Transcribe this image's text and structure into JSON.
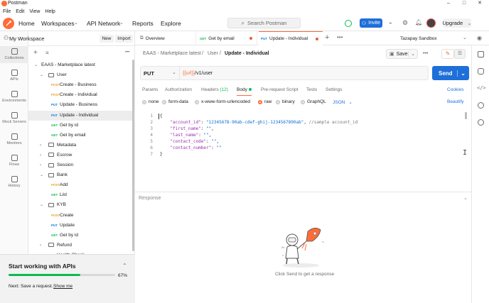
{
  "window": {
    "title": "Postman",
    "minimize": "–",
    "maximize": "□",
    "close": "✕"
  },
  "menu": [
    "File",
    "Edit",
    "View",
    "Help"
  ],
  "header": {
    "home": "Home",
    "workspaces": "Workspaces",
    "api_network": "API Network",
    "reports": "Reports",
    "explore": "Explore",
    "search_placeholder": "Search Postman",
    "invite": "Invite",
    "upgrade": "Upgrade"
  },
  "rail": [
    {
      "label": "Collections",
      "icon": "collections-icon"
    },
    {
      "label": "APIs",
      "icon": "apis-icon"
    },
    {
      "label": "Environments",
      "icon": "environments-icon"
    },
    {
      "label": "Mock Servers",
      "icon": "mock-servers-icon"
    },
    {
      "label": "Monitors",
      "icon": "monitors-icon"
    },
    {
      "label": "Flows",
      "icon": "flows-icon"
    },
    {
      "label": "History",
      "icon": "history-icon"
    }
  ],
  "sidebar": {
    "workspace_name": "My Workspace",
    "new_label": "New",
    "import_label": "Import",
    "tree": [
      {
        "label": "EAAS - Marketplace latest",
        "kind": "collection",
        "depth": 0,
        "open": true
      },
      {
        "label": "User",
        "kind": "folder",
        "depth": 1,
        "open": true
      },
      {
        "label": "Create - Business",
        "kind": "request",
        "method": "POST",
        "depth": 2
      },
      {
        "label": "Create - Individual",
        "kind": "request",
        "method": "POST",
        "depth": 2
      },
      {
        "label": "Update - Business",
        "kind": "request",
        "method": "PUT",
        "depth": 2
      },
      {
        "label": "Update - Individual",
        "kind": "request",
        "method": "PUT",
        "depth": 2,
        "selected": true
      },
      {
        "label": "Get by id",
        "kind": "request",
        "method": "GET",
        "depth": 2
      },
      {
        "label": "Get by email",
        "kind": "request",
        "method": "GET",
        "depth": 2
      },
      {
        "label": "Metadata",
        "kind": "folder",
        "depth": 1,
        "open": false
      },
      {
        "label": "Escrow",
        "kind": "folder",
        "depth": 1,
        "open": false
      },
      {
        "label": "Session",
        "kind": "folder",
        "depth": 1,
        "open": false
      },
      {
        "label": "Bank",
        "kind": "folder",
        "depth": 1,
        "open": true
      },
      {
        "label": "Add",
        "kind": "request",
        "method": "POST",
        "depth": 2
      },
      {
        "label": "List",
        "kind": "request",
        "method": "GET",
        "depth": 2
      },
      {
        "label": "KYB",
        "kind": "folder",
        "depth": 1,
        "open": true
      },
      {
        "label": "Create",
        "kind": "request",
        "method": "POST",
        "depth": 2
      },
      {
        "label": "Update",
        "kind": "request",
        "method": "PUT",
        "depth": 2
      },
      {
        "label": "Get by id",
        "kind": "request",
        "method": "GET",
        "depth": 2
      },
      {
        "label": "Refund",
        "kind": "folder",
        "depth": 1,
        "open": false
      },
      {
        "label": "Health Check",
        "kind": "request",
        "method": "GET",
        "depth": 1
      }
    ]
  },
  "start_panel": {
    "title": "Start working with APIs",
    "progress": 0.67,
    "progress_text": "67%",
    "next_prefix": "Next: Save a request.",
    "show_me": "Show me"
  },
  "tabs": [
    {
      "label": "Overview",
      "method": ""
    },
    {
      "label": "Get by email",
      "method": "GET",
      "dirty": true
    },
    {
      "label": "Update - Individual",
      "method": "PUT",
      "dirty": true,
      "active": true
    }
  ],
  "environment": "Tazapay Sandbox",
  "breadcrumb": {
    "collection": "EAAS - Marketplace latest",
    "sep": "/",
    "folder": "User",
    "request": "Update - Individual"
  },
  "save_label": "Save",
  "request": {
    "method": "PUT",
    "url_var": "{{url}}",
    "url_path": "/v1/user",
    "send_label": "Send"
  },
  "request_tabs": [
    {
      "label": "Params"
    },
    {
      "label": "Authorization"
    },
    {
      "label": "Headers",
      "count": "(12)"
    },
    {
      "label": "Body",
      "active": true
    },
    {
      "label": "Pre-request Script"
    },
    {
      "label": "Tests"
    },
    {
      "label": "Settings"
    }
  ],
  "cookies_label": "Cookies",
  "body_types": [
    "none",
    "form-data",
    "x-www-form-urlencoded",
    "raw",
    "binary",
    "GraphQL"
  ],
  "body_selected": "raw",
  "body_format": "JSON",
  "beautify_label": "Beautify",
  "code_lines": [
    {
      "n": "1",
      "tokens": [
        {
          "t": "{",
          "c": "p"
        }
      ]
    },
    {
      "n": "2",
      "tokens": [
        {
          "t": "    \"account_id\"",
          "c": "k"
        },
        {
          "t": ": ",
          "c": "p"
        },
        {
          "t": "\"12345678-90ab-cdef-ghij-1234567890ab\"",
          "c": "s"
        },
        {
          "t": ", ",
          "c": "p"
        },
        {
          "t": "//sample account_id",
          "c": "c"
        }
      ]
    },
    {
      "n": "3",
      "tokens": [
        {
          "t": "    \"first_name\"",
          "c": "k"
        },
        {
          "t": ": ",
          "c": "p"
        },
        {
          "t": "\"\"",
          "c": "s"
        },
        {
          "t": ",",
          "c": "p"
        }
      ]
    },
    {
      "n": "4",
      "tokens": [
        {
          "t": "    \"last_name\"",
          "c": "k"
        },
        {
          "t": ": ",
          "c": "p"
        },
        {
          "t": "\"\"",
          "c": "s"
        },
        {
          "t": ",",
          "c": "p"
        }
      ]
    },
    {
      "n": "5",
      "tokens": [
        {
          "t": "    \"contact_code\"",
          "c": "k"
        },
        {
          "t": ": ",
          "c": "p"
        },
        {
          "t": "\"\"",
          "c": "s"
        },
        {
          "t": ",",
          "c": "p"
        }
      ]
    },
    {
      "n": "6",
      "tokens": [
        {
          "t": "    \"contact_number\"",
          "c": "k"
        },
        {
          "t": ": ",
          "c": "p"
        },
        {
          "t": "\"\"",
          "c": "s"
        }
      ]
    },
    {
      "n": "7",
      "tokens": [
        {
          "t": "}",
          "c": "p"
        }
      ]
    }
  ],
  "response": {
    "title": "Response",
    "empty_text": "Click Send to get a response"
  },
  "colors": {
    "accent": "#ff6c37",
    "primary": "#1e6fd9",
    "post": "#e8a02c",
    "put": "#097bed",
    "get": "#0cbb52"
  }
}
